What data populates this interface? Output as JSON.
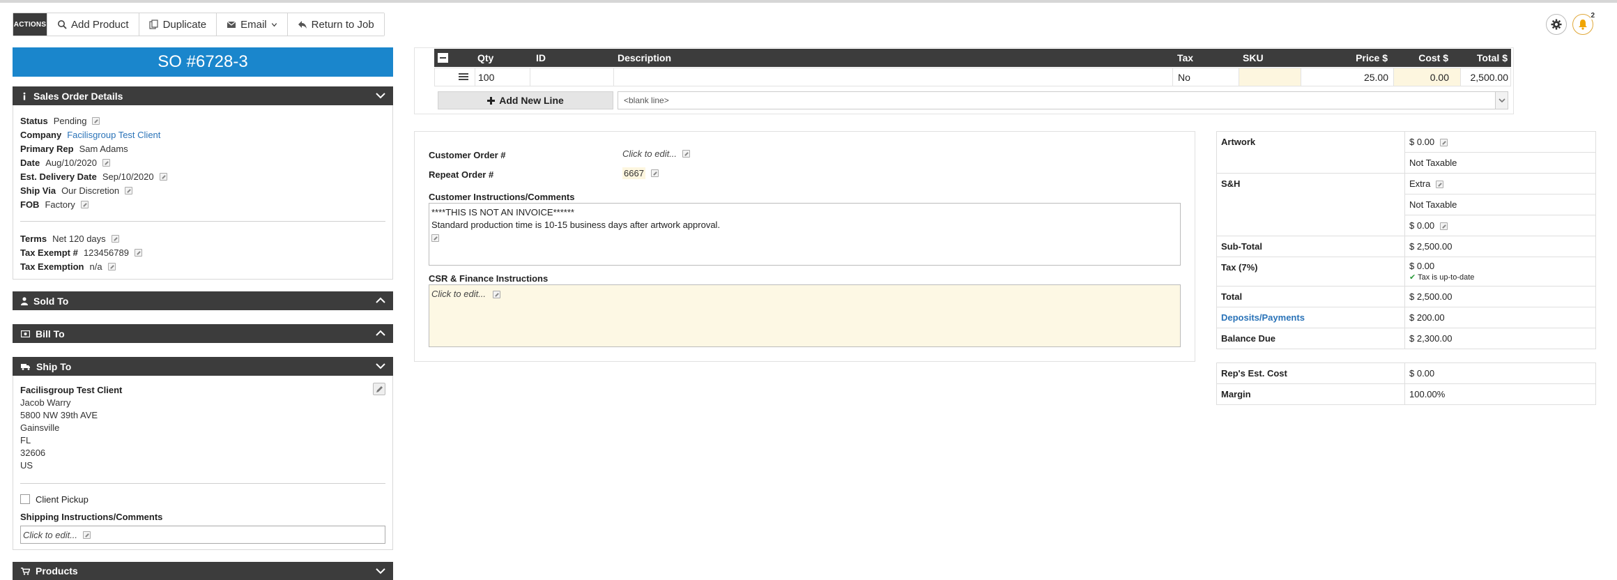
{
  "toolbar": {
    "actions_label": "ACTIONS",
    "add_product": "Add Product",
    "duplicate": "Duplicate",
    "email": "Email",
    "return_to_job": "Return to Job"
  },
  "notifications": {
    "count": "2"
  },
  "order": {
    "title": "SO #6728-3"
  },
  "sales_order_details": {
    "heading": "Sales Order Details",
    "fields": [
      {
        "label": "Status",
        "value": "Pending"
      },
      {
        "label": "Company",
        "value": "Facilisgroup Test Client"
      },
      {
        "label": "Primary Rep",
        "value": "Sam Adams"
      },
      {
        "label": "Date",
        "value": "Aug/10/2020"
      },
      {
        "label": "Est. Delivery Date",
        "value": "Sep/10/2020"
      },
      {
        "label": "Ship Via",
        "value": "Our Discretion"
      },
      {
        "label": "FOB",
        "value": "Factory"
      }
    ],
    "fields2": [
      {
        "label": "Terms",
        "value": "Net 120 days"
      },
      {
        "label": "Tax Exempt #",
        "value": "123456789"
      },
      {
        "label": "Tax Exemption",
        "value": "n/a"
      }
    ]
  },
  "sold_to": {
    "heading": "Sold To"
  },
  "bill_to": {
    "heading": "Bill To"
  },
  "ship_to": {
    "heading": "Ship To",
    "company": "Facilisgroup Test Client",
    "lines": [
      "Jacob Warry",
      "5800 NW 39th AVE",
      "Gainsville",
      "FL",
      "32606",
      "US"
    ],
    "client_pickup": "Client Pickup",
    "instructions_label": "Shipping Instructions/Comments",
    "instructions_placeholder": "Click to edit..."
  },
  "products": {
    "heading": "Products"
  },
  "line_items": {
    "columns": {
      "qty": "Qty",
      "id": "ID",
      "description": "Description",
      "tax": "Tax",
      "sku": "SKU",
      "price": "Price $",
      "cost": "Cost $",
      "total": "Total $"
    },
    "row": {
      "qty": "100",
      "id": "",
      "description": "",
      "tax": "No",
      "sku": "",
      "price": "25.00",
      "cost": "0.00",
      "total": "2,500.00"
    },
    "add_new_line": "Add New Line",
    "blank_line": "<blank line>"
  },
  "order_info": {
    "customer_order_label": "Customer Order #",
    "customer_order_value": "Click to edit...",
    "repeat_order_label": "Repeat Order #",
    "repeat_order_value": "6667",
    "instructions_label": "Customer Instructions/Comments",
    "instructions_line1": "****THIS IS NOT AN INVOICE******",
    "instructions_line2": "Standard production time is 10-15 business days after artwork approval.",
    "csr_label": "CSR & Finance Instructions",
    "csr_value": "Click to edit..."
  },
  "totals": {
    "artwork_label": "Artwork",
    "artwork_value": "$ 0.00",
    "artwork_tax": "Not Taxable",
    "sh_label": "S&H",
    "sh_value": "Extra",
    "sh_tax": "Not Taxable",
    "sh_amount": "$ 0.00",
    "subtotal_label": "Sub-Total",
    "subtotal_value": "$ 2,500.00",
    "tax_label": "Tax (7%)",
    "tax_value": "$ 0.00",
    "tax_status": "Tax is up-to-date",
    "total_label": "Total",
    "total_value": "$ 2,500.00",
    "deposits_label": "Deposits/Payments",
    "deposits_value": "$ 200.00",
    "balance_label": "Balance Due",
    "balance_value": "$ 2,300.00",
    "rep_cost_label": "Rep's Est. Cost",
    "rep_cost_value": "$ 0.00",
    "margin_label": "Margin",
    "margin_value": "100.00%"
  }
}
